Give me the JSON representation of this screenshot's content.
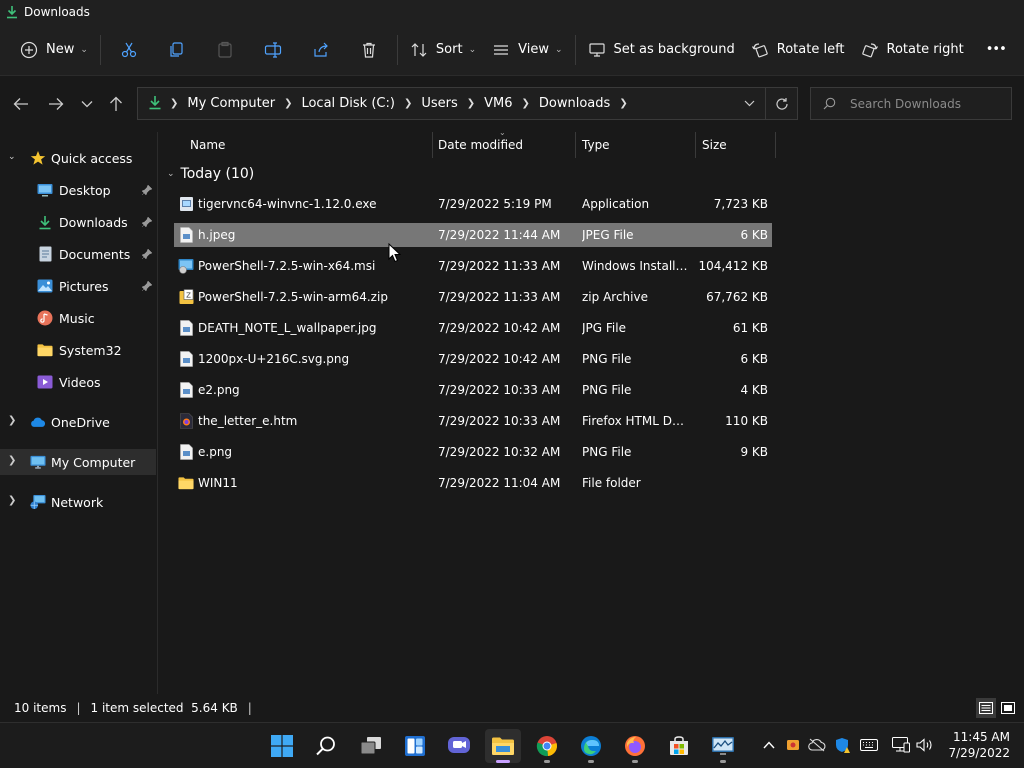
{
  "window": {
    "title": "Downloads"
  },
  "commandbar": {
    "new_label": "New",
    "sort_label": "Sort",
    "view_label": "View",
    "set_background_label": "Set as background",
    "rotate_left_label": "Rotate left",
    "rotate_right_label": "Rotate right",
    "more_label": "•••"
  },
  "address": {
    "crumbs": [
      "My Computer",
      "Local Disk (C:)",
      "Users",
      "VM6",
      "Downloads"
    ],
    "search_placeholder": "Search Downloads"
  },
  "sidebar": {
    "quick_access": "Quick access",
    "items": [
      {
        "label": "Desktop",
        "icon": "desktop-icon",
        "pinned": true
      },
      {
        "label": "Downloads",
        "icon": "downloads-icon",
        "pinned": true
      },
      {
        "label": "Documents",
        "icon": "documents-icon",
        "pinned": true
      },
      {
        "label": "Pictures",
        "icon": "pictures-icon",
        "pinned": true
      },
      {
        "label": "Music",
        "icon": "music-icon",
        "pinned": false
      },
      {
        "label": "System32",
        "icon": "folder-icon",
        "pinned": false
      },
      {
        "label": "Videos",
        "icon": "videos-icon",
        "pinned": false
      }
    ],
    "onedrive": "OneDrive",
    "my_computer": "My Computer",
    "network": "Network"
  },
  "columns": {
    "name": "Name",
    "date": "Date modified",
    "type": "Type",
    "size": "Size"
  },
  "group": {
    "label": "Today (10)"
  },
  "files": [
    {
      "name": "tigervnc64-winvnc-1.12.0.exe",
      "date": "7/29/2022 5:19 PM",
      "type": "Application",
      "size": "7,723 KB",
      "icon": "exe-icon"
    },
    {
      "name": "h.jpeg",
      "date": "7/29/2022 11:44 AM",
      "type": "JPEG File",
      "size": "6 KB",
      "icon": "image-file-icon",
      "selected": true
    },
    {
      "name": "PowerShell-7.2.5-win-x64.msi",
      "date": "7/29/2022 11:33 AM",
      "type": "Windows Installer ...",
      "size": "104,412 KB",
      "icon": "msi-icon"
    },
    {
      "name": "PowerShell-7.2.5-win-arm64.zip",
      "date": "7/29/2022 11:33 AM",
      "type": "zip Archive",
      "size": "67,762 KB",
      "icon": "zip-icon"
    },
    {
      "name": "DEATH_NOTE_L_wallpaper.jpg",
      "date": "7/29/2022 10:42 AM",
      "type": "JPG File",
      "size": "61 KB",
      "icon": "image-file-icon"
    },
    {
      "name": "1200px-U+216C.svg.png",
      "date": "7/29/2022 10:42 AM",
      "type": "PNG File",
      "size": "6 KB",
      "icon": "image-file-icon"
    },
    {
      "name": "e2.png",
      "date": "7/29/2022 10:33 AM",
      "type": "PNG File",
      "size": "4 KB",
      "icon": "image-file-icon"
    },
    {
      "name": "the_letter_e.htm",
      "date": "7/29/2022 10:33 AM",
      "type": "Firefox HTML Doc...",
      "size": "110 KB",
      "icon": "firefox-html-icon"
    },
    {
      "name": "e.png",
      "date": "7/29/2022 10:32 AM",
      "type": "PNG File",
      "size": "9 KB",
      "icon": "image-file-icon"
    },
    {
      "name": "WIN11",
      "date": "7/29/2022 11:04 AM",
      "type": "File folder",
      "size": "",
      "icon": "folder-icon"
    }
  ],
  "status": {
    "count": "10 items",
    "selection": "1 item selected  5.64 KB"
  },
  "clock": {
    "time": "11:45 AM",
    "date": "7/29/2022"
  },
  "colors": {
    "accent": "#0078d4",
    "selection": "#777777",
    "background": "#191919"
  }
}
